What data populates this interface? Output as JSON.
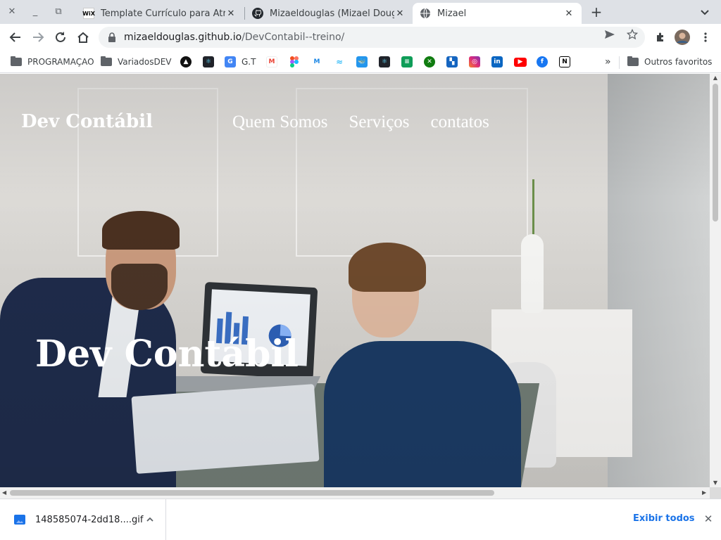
{
  "browser": {
    "window_buttons": {
      "close": "✕",
      "minimize": "_",
      "restore": "⧉"
    },
    "tabs": [
      {
        "title": "Template Currículo para Atriz",
        "favicon": "wix-icon",
        "favicon_text": "WiX",
        "active": false
      },
      {
        "title": "Mizaeldouglas (Mizael Douglas",
        "favicon": "github-icon",
        "active": false
      },
      {
        "title": "Mizael",
        "favicon": "globe-icon",
        "active": true
      }
    ],
    "tab_close": "✕",
    "new_tab": "+",
    "url": {
      "host": "mizaeldouglas.github.io",
      "path": "/DevContabil--treino/"
    }
  },
  "bookmarks": {
    "items": [
      {
        "label": "PROGRAMAÇAO",
        "type": "folder"
      },
      {
        "label": "VariadosDEV",
        "type": "folder"
      },
      {
        "label": "",
        "icon": "vercel-icon",
        "color": "#111111"
      },
      {
        "label": "",
        "icon": "react-icon",
        "color": "#20232a"
      },
      {
        "label": "G.T",
        "icon": "google-translate-icon",
        "color": "#4285f4"
      },
      {
        "label": "",
        "icon": "gmail-icon",
        "color": "#ea4335"
      },
      {
        "label": "",
        "icon": "figma-icon",
        "color": "#a259ff"
      },
      {
        "label": "",
        "icon": "mui-icon",
        "color": "#1e88e5"
      },
      {
        "label": "",
        "icon": "tailwind-icon",
        "color": "#38bdf8"
      },
      {
        "label": "",
        "icon": "docker-icon",
        "color": "#2496ed"
      },
      {
        "label": "",
        "icon": "react-icon",
        "color": "#20232a"
      },
      {
        "label": "",
        "icon": "spreadsheet-icon",
        "color": "#0f9d58"
      },
      {
        "label": "",
        "icon": "xbox-icon",
        "color": "#107c10"
      },
      {
        "label": "",
        "icon": "stats-icon",
        "color": "#1565c0"
      },
      {
        "label": "",
        "icon": "instagram-icon",
        "color": "#e1306c"
      },
      {
        "label": "",
        "icon": "linkedin-icon",
        "color": "#0a66c2"
      },
      {
        "label": "",
        "icon": "youtube-icon",
        "color": "#ff0000"
      },
      {
        "label": "",
        "icon": "facebook-icon",
        "color": "#1877f2"
      },
      {
        "label": "",
        "icon": "notion-icon",
        "color": "#000000"
      }
    ],
    "overflow": "»",
    "other": "Outros favoritos"
  },
  "site": {
    "brand": "Dev Contábil",
    "nav": [
      "Quem Somos",
      "Serviços",
      "contatos"
    ],
    "hero_title": "Dev Contábil"
  },
  "downloads": {
    "file": "148585074-2dd18....gif",
    "show_all": "Exibir todos"
  }
}
